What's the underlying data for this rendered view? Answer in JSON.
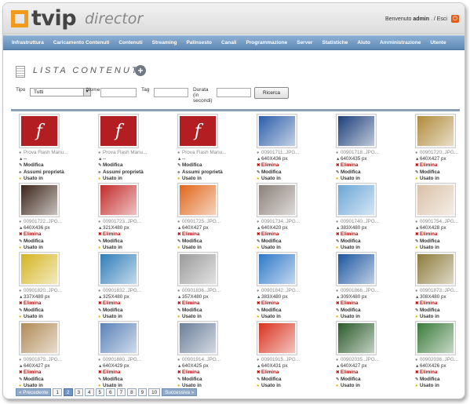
{
  "app": {
    "logo_main": "tvip",
    "logo_sub": "director",
    "welcome_prefix": "Benvenuto",
    "user": "admin",
    "separator": ". / Esci"
  },
  "menu": [
    "Infrastruttura",
    "Caricamento Contenuti",
    "Contenuti",
    "Streaming",
    "Palinsesto",
    "Canali",
    "Programmazione",
    "Server",
    "Statistiche",
    "Aiuto",
    "Amministrazione",
    "Utente"
  ],
  "page": {
    "title": "LISTA CONTENUTI"
  },
  "filters": {
    "tipo_label": "Tipo",
    "tipo_value": "Tutti",
    "nome_label": "Nome",
    "tag_label": "Tag",
    "durata_label_1": "Durata",
    "durata_label_2": "(in",
    "durata_label_3": "secondi)",
    "search_label": "Ricerca"
  },
  "colors": {
    "menubar": "#6f95c0",
    "elimina": "#b01010",
    "flash": "#b21e22",
    "logo_accent": "#f29a1a"
  },
  "tiles": [
    {
      "fname": "Prova Flash Manu...",
      "dim": "--",
      "kind": "flash",
      "actions": [
        "Modifica",
        "Assumi proprietà",
        "Usato in"
      ],
      "color": "#b21e22"
    },
    {
      "fname": "Prova Flash Manu...",
      "dim": "--",
      "kind": "flash",
      "actions": [
        "Modifica",
        "Assumi proprietà",
        "Usato in"
      ],
      "color": "#b21e22"
    },
    {
      "fname": "Prova Flash Manu...",
      "dim": "--",
      "kind": "flash",
      "actions": [
        "Modifica",
        "Assumi proprietà",
        "Usato in"
      ],
      "color": "#b21e22"
    },
    {
      "fname": "00901711..JPG...",
      "dim": "640X436 px",
      "kind": "img",
      "actions": [
        "Elimina",
        "Modifica",
        "Usato in"
      ],
      "color": "#2b5da8"
    },
    {
      "fname": "00901718..JPG...",
      "dim": "640X435 px",
      "kind": "img",
      "actions": [
        "Elimina",
        "Modifica",
        "Usato in"
      ],
      "color": "#1c3f7a"
    },
    {
      "fname": "00901720..JPG...",
      "dim": "640X427 px",
      "kind": "img",
      "actions": [
        "Elimina",
        "Modifica",
        "Usato in"
      ],
      "color": "#b08a3a"
    },
    {
      "fname": "00901722..JPG...",
      "dim": "640X436 px",
      "kind": "img",
      "actions": [
        "Elimina",
        "Modifica",
        "Usato in"
      ],
      "color": "#3a2418"
    },
    {
      "fname": "00901723..JPG...",
      "dim": "321X480 px",
      "kind": "img",
      "actions": [
        "Elimina",
        "Modifica",
        "Usato in"
      ],
      "color": "#c42a2a"
    },
    {
      "fname": "00901725..JPG...",
      "dim": "640X427 px",
      "kind": "img",
      "actions": [
        "Elimina",
        "Modifica",
        "Usato in"
      ],
      "color": "#e0661a"
    },
    {
      "fname": "00901734..JPG...",
      "dim": "640X420 px",
      "kind": "img",
      "actions": [
        "Elimina",
        "Modifica",
        "Usato in"
      ],
      "color": "#8a8078"
    },
    {
      "fname": "00901740..JPG...",
      "dim": "383X480 px",
      "kind": "img",
      "actions": [
        "Elimina",
        "Modifica",
        "Usato in"
      ],
      "color": "#6aa6d6"
    },
    {
      "fname": "00901754..JPG...",
      "dim": "640X428 px",
      "kind": "img",
      "actions": [
        "Elimina",
        "Modifica",
        "Usato in"
      ],
      "color": "#d9c1a6"
    },
    {
      "fname": "00901820..JPG...",
      "dim": "337X480 px",
      "kind": "img",
      "actions": [
        "Elimina",
        "Modifica",
        "Usato in"
      ],
      "color": "#d4b420"
    },
    {
      "fname": "00901832..JPG...",
      "dim": "325X480 px",
      "kind": "img",
      "actions": [
        "Elimina",
        "Modifica",
        "Usato in"
      ],
      "color": "#2f7db8"
    },
    {
      "fname": "00901836..JPG...",
      "dim": "357X480 px",
      "kind": "img",
      "actions": [
        "Elimina",
        "Modifica",
        "Usato in"
      ],
      "color": "#9a9a9a"
    },
    {
      "fname": "00901842..JPG...",
      "dim": "383X480 px",
      "kind": "img",
      "actions": [
        "Elimina",
        "Modifica",
        "Usato in"
      ],
      "color": "#2e78c8"
    },
    {
      "fname": "00901866..JPG...",
      "dim": "309X480 px",
      "kind": "img",
      "actions": [
        "Elimina",
        "Modifica",
        "Usato in"
      ],
      "color": "#1c56a0"
    },
    {
      "fname": "00901873..JPG...",
      "dim": "308X480 px",
      "kind": "img",
      "actions": [
        "Elimina",
        "Modifica",
        "Usato in"
      ],
      "color": "#8a7a3a"
    },
    {
      "fname": "00901879..JPG...",
      "dim": "640X427 px",
      "kind": "img",
      "actions": [
        "Elimina",
        "Modifica",
        "Usato in"
      ],
      "color": "#b08a56"
    },
    {
      "fname": "00901880..JPG...",
      "dim": "640X429 px",
      "kind": "img",
      "actions": [
        "Elimina",
        "Modifica",
        "Usato in"
      ],
      "color": "#5a82b8"
    },
    {
      "fname": "00901914..JPG...",
      "dim": "640X425 px",
      "kind": "img",
      "actions": [
        "Elimina",
        "Modifica",
        "Usato in"
      ],
      "color": "#6a7e9a"
    },
    {
      "fname": "00901915..JPG...",
      "dim": "640X431 px",
      "kind": "img",
      "actions": [
        "Elimina",
        "Modifica",
        "Usato in"
      ],
      "color": "#d8321e"
    },
    {
      "fname": "00902035..JPG...",
      "dim": "640X427 px",
      "kind": "img",
      "actions": [
        "Elimina",
        "Modifica",
        "Usato in"
      ],
      "color": "#2a5a2a"
    },
    {
      "fname": "00902036..JPG...",
      "dim": "640X426 px",
      "kind": "img",
      "actions": [
        "Elimina",
        "Modifica",
        "Usato in"
      ],
      "color": "#3a7a3a"
    }
  ],
  "pager": {
    "prev": "« Precedente",
    "pages": [
      "1",
      "2",
      "3",
      "4",
      "5",
      "6",
      "7",
      "8",
      "9",
      "10"
    ],
    "active": "2",
    "next": "Successiva »"
  }
}
